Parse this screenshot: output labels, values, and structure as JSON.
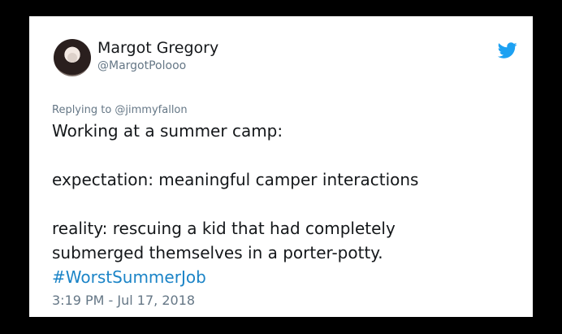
{
  "author": {
    "name": "Margot Gregory",
    "handle": "@MargotPolooo"
  },
  "tweet": {
    "replying_to": "Replying to @jimmyfallon",
    "lines": [
      "Working at a summer camp:",
      "expectation: meaningful camper interactions",
      "reality: rescuing a kid that had completely",
      "submerged themselves in a porter-potty."
    ],
    "hashtag": "#WorstSummerJob",
    "timestamp": "3:19 PM - Jul 17, 2018"
  },
  "icons": {
    "brand": "twitter-bird-icon",
    "brand_color": "#1da1f2"
  },
  "colors": {
    "hashtag": "#1b84c7",
    "secondary_text": "#657786",
    "primary_text": "#14171a"
  }
}
